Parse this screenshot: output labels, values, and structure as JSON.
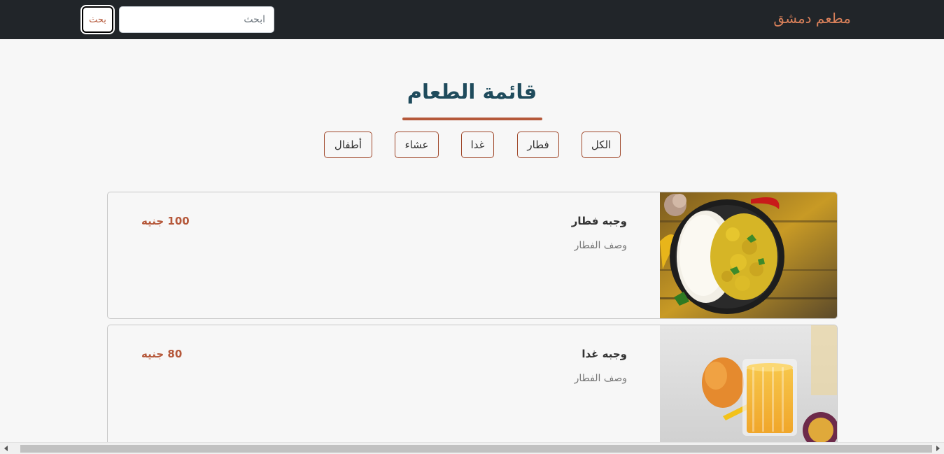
{
  "navbar": {
    "brand": "مطعم دمشق",
    "search_placeholder": "ابحث",
    "search_button": "بحث"
  },
  "menu": {
    "title": "قائمة الطعام",
    "filters": [
      {
        "label": "الكل"
      },
      {
        "label": "فطار"
      },
      {
        "label": "غدا"
      },
      {
        "label": "عشاء"
      },
      {
        "label": "أطفال"
      }
    ]
  },
  "items": [
    {
      "name": "وجبه فطار",
      "description": "وصف الفطار",
      "price": "100 جنيه",
      "image_icon": "curry-rice-dish-image"
    },
    {
      "name": "وجبه غدا",
      "description": "وصف الفطار",
      "price": "80 جنيه",
      "image_icon": "mango-juice-image"
    }
  ],
  "colors": {
    "navbar_bg": "#212529",
    "brand": "#d9805a",
    "accent": "#b5583a",
    "title": "#1f4b5c"
  }
}
